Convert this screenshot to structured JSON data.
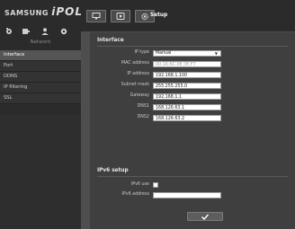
{
  "brand": {
    "part1": "SAMSUNG",
    "part2": "iPOLiS"
  },
  "sidebar": {
    "icons": [
      "camera-icon",
      "recorder-icon",
      "user-icon",
      "settings-icon"
    ],
    "section_label": "Network",
    "items": [
      {
        "label": "Interface",
        "active": true
      },
      {
        "label": "Port",
        "active": false
      },
      {
        "label": "DDNS",
        "active": false
      },
      {
        "label": "IP filtering",
        "active": false
      },
      {
        "label": "SSL",
        "active": false
      }
    ]
  },
  "toolbar": {
    "buttons": [
      "monitor-icon",
      "playback-icon",
      "gear-icon"
    ],
    "setup_label": "Setup"
  },
  "interface": {
    "title": "Interface",
    "ip_type": {
      "label": "IP type",
      "value": "Manual"
    },
    "mac": {
      "label": "MAC address",
      "value": "00:16:6C:0E:3E:F7"
    },
    "ip": {
      "label": "IP address",
      "value": "192.168.1.100"
    },
    "subnet": {
      "label": "Subnet mask",
      "value": "255.255.255.0"
    },
    "gateway": {
      "label": "Gateway",
      "value": "192.168.1.1"
    },
    "dns1": {
      "label": "DNS1",
      "value": "168.126.63.1"
    },
    "dns2": {
      "label": "DNS2",
      "value": "168.126.63.2"
    }
  },
  "ipv6": {
    "title": "IPv6 setup",
    "use_label": "IPv6 use",
    "address_label": "IPv6 address",
    "address_value": ""
  },
  "apply": {
    "icon": "checkmark-icon"
  }
}
